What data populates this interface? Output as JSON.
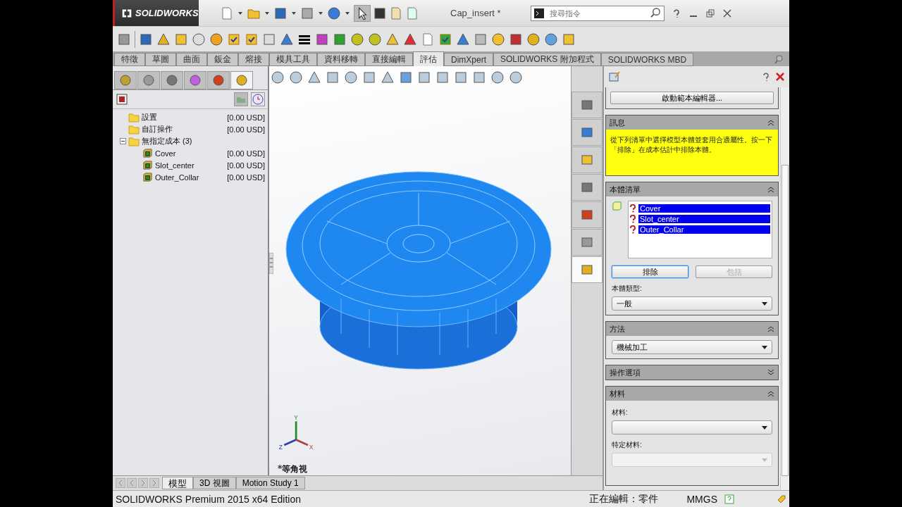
{
  "window": {
    "logo": "SOLIDWORKS",
    "title": "Cap_insert *",
    "search": {
      "placeholder": "搜尋指令"
    }
  },
  "command_tabs": [
    {
      "label": "特徵",
      "selected": false
    },
    {
      "label": "草圖",
      "selected": false
    },
    {
      "label": "曲面",
      "selected": false
    },
    {
      "label": "鈑金",
      "selected": false
    },
    {
      "label": "熔接",
      "selected": false
    },
    {
      "label": "模具工具",
      "selected": false
    },
    {
      "label": "資料移轉",
      "selected": false
    },
    {
      "label": "直接編輯",
      "selected": false
    },
    {
      "label": "評估",
      "selected": true
    },
    {
      "label": "DimXpert",
      "selected": false
    },
    {
      "label": "SOLIDWORKS 附加程式",
      "selected": false
    },
    {
      "label": "SOLIDWORKS MBD",
      "selected": false
    }
  ],
  "panel_tabs": [
    {
      "selected": false
    },
    {
      "selected": false
    },
    {
      "selected": false
    },
    {
      "selected": false
    },
    {
      "selected": false
    },
    {
      "selected": true
    }
  ],
  "tree": [
    {
      "label": "設置",
      "cost": "[0.00 USD]"
    },
    {
      "label": "自訂操作",
      "cost": "[0.00 USD]"
    },
    {
      "label": "無指定成本 (3)",
      "expanded": true,
      "children": [
        {
          "label": "Cover",
          "cost": "[0.00 USD]"
        },
        {
          "label": "Slot_center",
          "cost": "[0.00 USD]"
        },
        {
          "label": "Outer_Collar",
          "cost": "[0.00 USD]"
        }
      ]
    }
  ],
  "viewport": {
    "view_label": "*等角視",
    "axes": {
      "y": "Y",
      "z": "Z",
      "x": "X"
    }
  },
  "task_pane": [
    {
      "selected": false
    },
    {
      "selected": false
    },
    {
      "selected": false
    },
    {
      "selected": false
    },
    {
      "selected": false
    },
    {
      "selected": false
    },
    {
      "selected": true
    }
  ],
  "property_manager": {
    "launch_button": "啟動範本編輯器...",
    "message": {
      "title": "訊息",
      "expanded": true,
      "text": "從下列清單中選擇模型本體並套用合適屬性。按一下「排除」在成本估計中排除本體。"
    },
    "body_list": {
      "title": "本體清單",
      "expanded": true,
      "bodies": [
        {
          "name": "Cover",
          "selected": true
        },
        {
          "name": "Slot_center",
          "selected": true
        },
        {
          "name": "Outer_Collar",
          "selected": true
        }
      ],
      "exclude_button": {
        "label": "排除",
        "disabled": false
      },
      "include_button": {
        "label": "包括",
        "disabled": true
      },
      "type_label": "本體類型:",
      "type_value": "一般"
    },
    "method": {
      "title": "方法",
      "expanded": true,
      "value": "機械加工"
    },
    "operation_options": {
      "title": "操作選項",
      "expanded": false
    },
    "material": {
      "title": "材料",
      "expanded": true,
      "material_label": "材料:",
      "specific_label": "特定材料:",
      "specific_disabled": true
    }
  },
  "bottom_tabs": [
    {
      "label": "模型",
      "selected": true
    },
    {
      "label": "3D 視圖",
      "selected": false
    },
    {
      "label": "Motion Study 1",
      "selected": false
    }
  ],
  "status_bar": {
    "edition": "SOLIDWORKS Premium 2015 x64 Edition",
    "editing": "正在編輯：零件",
    "units": "MMGS"
  }
}
